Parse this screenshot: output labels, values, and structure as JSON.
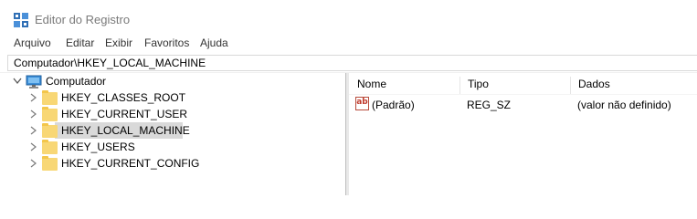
{
  "window": {
    "title": "Editor do Registro",
    "icon": "registry-editor-icon"
  },
  "menu": {
    "items": [
      "Arquivo",
      "Editar",
      "Exibir",
      "Favoritos",
      "Ajuda"
    ]
  },
  "address": {
    "path": "Computador\\HKEY_LOCAL_MACHINE"
  },
  "tree": {
    "root": {
      "label": "Computador",
      "icon": "computer-icon",
      "expanded": true
    },
    "children": [
      {
        "label": "HKEY_CLASSES_ROOT",
        "icon": "folder-icon",
        "selected": false
      },
      {
        "label": "HKEY_CURRENT_USER",
        "icon": "folder-icon",
        "selected": false
      },
      {
        "label": "HKEY_LOCAL_MACHINE",
        "icon": "folder-icon",
        "selected": true
      },
      {
        "label": "HKEY_USERS",
        "icon": "folder-icon",
        "selected": false
      },
      {
        "label": "HKEY_CURRENT_CONFIG",
        "icon": "folder-icon",
        "selected": false
      }
    ]
  },
  "list": {
    "columns": [
      "Nome",
      "Tipo",
      "Dados"
    ],
    "rows": [
      {
        "icon": "string-value-icon",
        "name": "(Padrão)",
        "type": "REG_SZ",
        "data": "(valor não definido)"
      }
    ]
  },
  "colors": {
    "selection": "#d9d9d9",
    "folder": "#f8d775",
    "title_text": "#7a7a7a"
  }
}
